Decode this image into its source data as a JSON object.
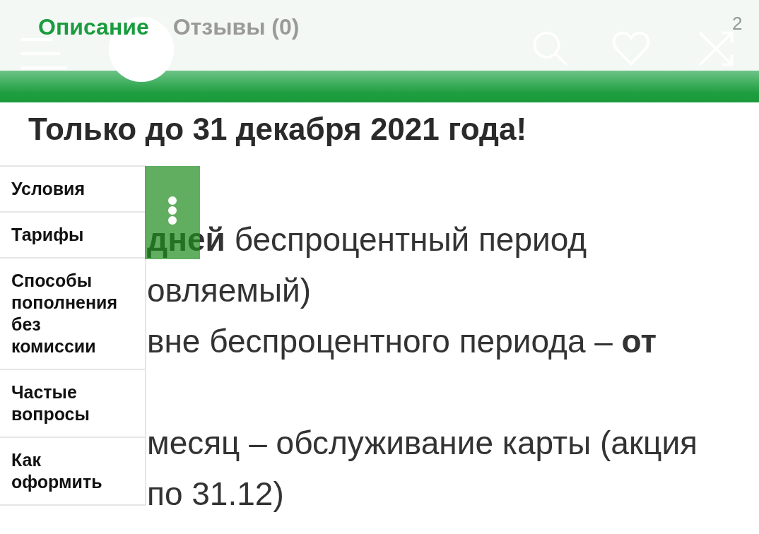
{
  "tabs": [
    {
      "label": "Описание",
      "selected": true
    },
    {
      "label": "Отзывы (0)",
      "selected": false
    }
  ],
  "header": {
    "badge": "2"
  },
  "title": "Только до 31 декабря 2021 года!",
  "side_menu": {
    "items": [
      "Условия",
      "Тарифы",
      "Способы пополнения без комиссии",
      "Частые вопросы",
      "Как оформить"
    ]
  },
  "body_paragraphs": [
    [
      "**дней** беспроцентный период",
      "овляемый)",
      "вне беспроцентного периода – **от**"
    ],
    [
      "месяц – обслуживание карты (акция",
      "по 31.12)"
    ]
  ]
}
